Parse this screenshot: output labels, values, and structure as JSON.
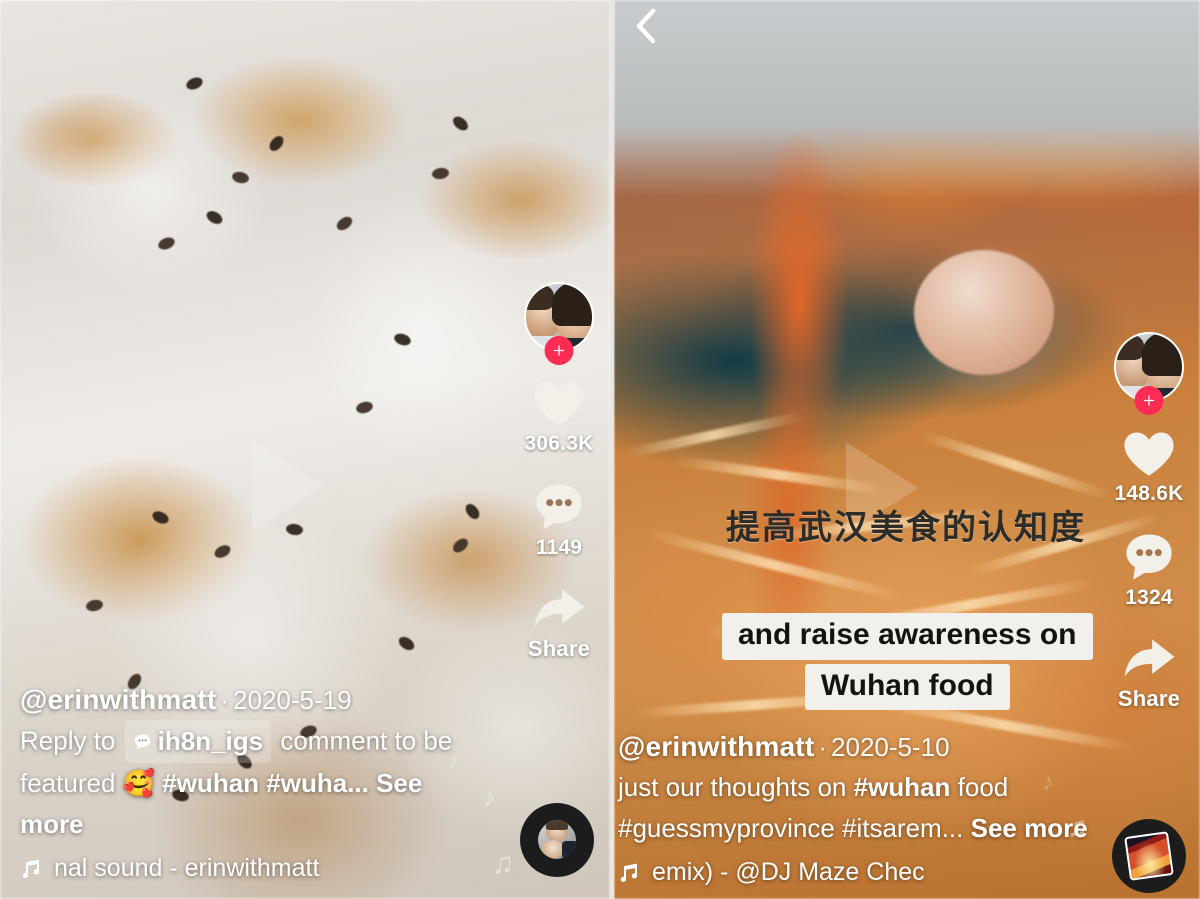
{
  "app": {
    "name": "TikTok",
    "accent_color": "#fe2c55",
    "text_color": "#ffffff"
  },
  "panels": [
    {
      "id": "left-video",
      "nav": {
        "back_visible": false,
        "back_icon": "chevron-left-icon"
      },
      "video": {
        "description": "Close-up of white glutinous rice balls topped with pork floss and black sesame seeds",
        "play_overlay_icon": "play-triangle-icon"
      },
      "author": {
        "username": "@erinwithmatt",
        "separator": "·",
        "date": "2020-5-19",
        "avatar_alt": "erinwithmatt-avatar",
        "follow_icon": "plus-icon"
      },
      "caption": {
        "prefix": "Reply to",
        "reply_badge_icon": "comment-bubble-icon",
        "reply_badge_user": "ih8n_igs",
        "middle": "comment to be",
        "line2_before": "featured",
        "emoji": "🥰",
        "hashtags": "#wuhan #wuha...",
        "see_more": "See more"
      },
      "sound": {
        "icon": "music-note-icon",
        "marquee_text": "nal sound - erinwithmatt",
        "disc_icon": "music-disc-icon",
        "disc_type": "avatar"
      },
      "actions": [
        {
          "name": "like",
          "icon": "heart-icon",
          "count": "306.3K"
        },
        {
          "name": "comment",
          "icon": "comment-bubble-icon",
          "count": "1149"
        },
        {
          "name": "share",
          "icon": "share-arrow-icon",
          "count": "Share"
        }
      ]
    },
    {
      "id": "right-video",
      "nav": {
        "back_visible": true,
        "back_icon": "chevron-left-icon"
      },
      "video": {
        "description": "Orange chili sauce being poured into a dark teal bowl of noodles with a marinated egg",
        "play_overlay_icon": "play-triangle-icon"
      },
      "overlay": {
        "chinese_subtitle": "提高武汉美食的认知度",
        "english_subtitle_lines": [
          "and raise awareness on",
          "Wuhan food"
        ]
      },
      "author": {
        "username": "@erinwithmatt",
        "separator": "·",
        "date": "2020-5-10",
        "avatar_alt": "erinwithmatt-avatar",
        "follow_icon": "plus-icon"
      },
      "caption": {
        "line1_a": "just our thoughts on ",
        "line1_tag": "#wuhan",
        "line1_b": " food",
        "line2_tags": "#guessmyprovince #itsarem...",
        "see_more": "See more"
      },
      "sound": {
        "icon": "music-note-icon",
        "marquee_text": "emix) - @DJ Maze    Chec",
        "disc_icon": "music-disc-icon",
        "disc_type": "album-art"
      },
      "actions": [
        {
          "name": "like",
          "icon": "heart-icon",
          "count": "148.6K"
        },
        {
          "name": "comment",
          "icon": "comment-bubble-icon",
          "count": "1324"
        },
        {
          "name": "share",
          "icon": "share-arrow-icon",
          "count": "Share"
        }
      ]
    }
  ]
}
